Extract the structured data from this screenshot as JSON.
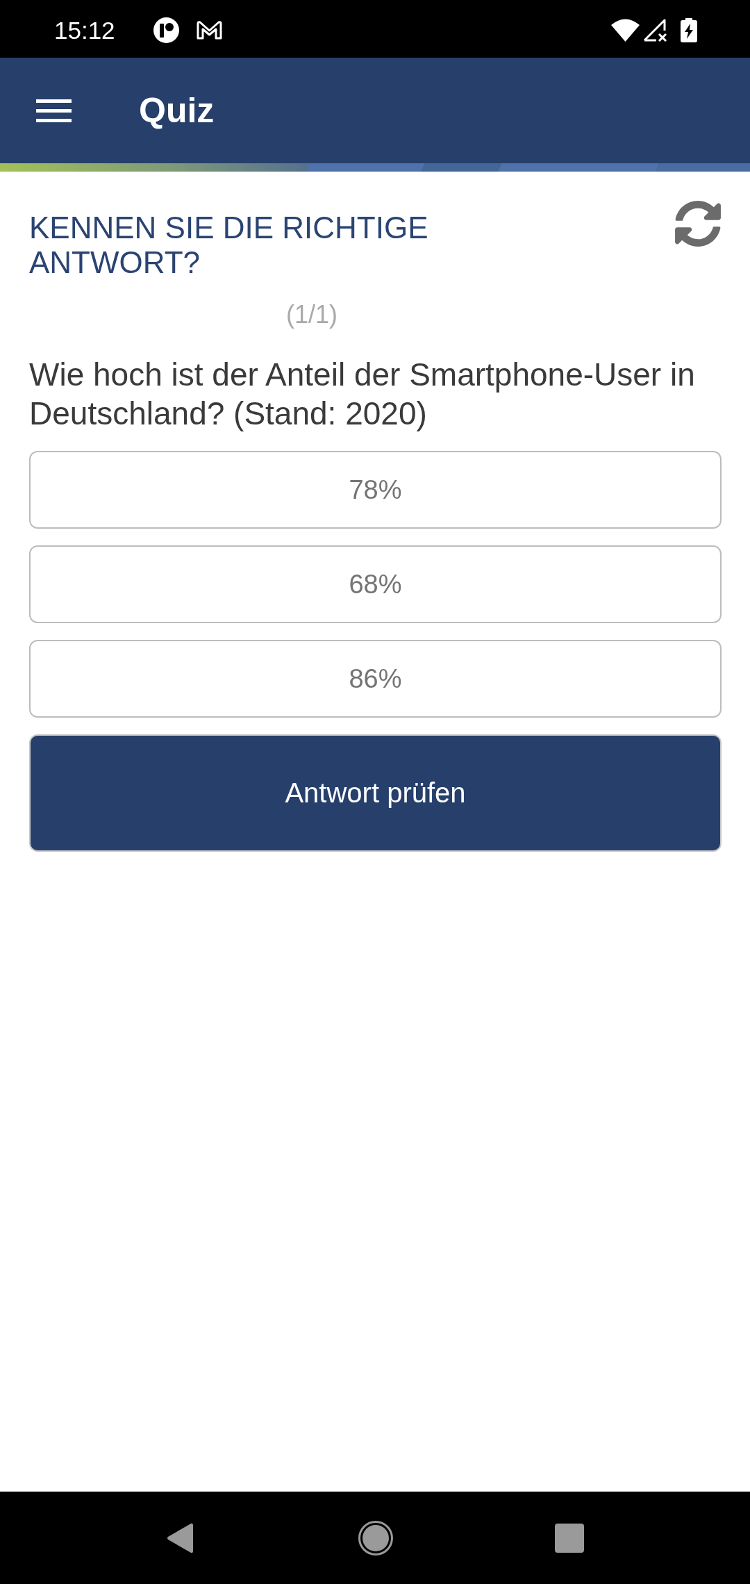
{
  "status_bar": {
    "time": "15:12"
  },
  "app_bar": {
    "title": "Quiz"
  },
  "quiz": {
    "heading": "KENNEN SIE DIE RICHTIGE ANTWORT?",
    "counter": "(1/1)",
    "question": "Wie hoch ist der Anteil der Smartphone-User in Deutschland? (Stand: 2020)",
    "options": [
      {
        "label": "78%",
        "selected": false
      },
      {
        "label": "68%",
        "selected": false
      },
      {
        "label": "86%",
        "selected": false
      }
    ],
    "submit_button": "Antwort prüfen"
  }
}
